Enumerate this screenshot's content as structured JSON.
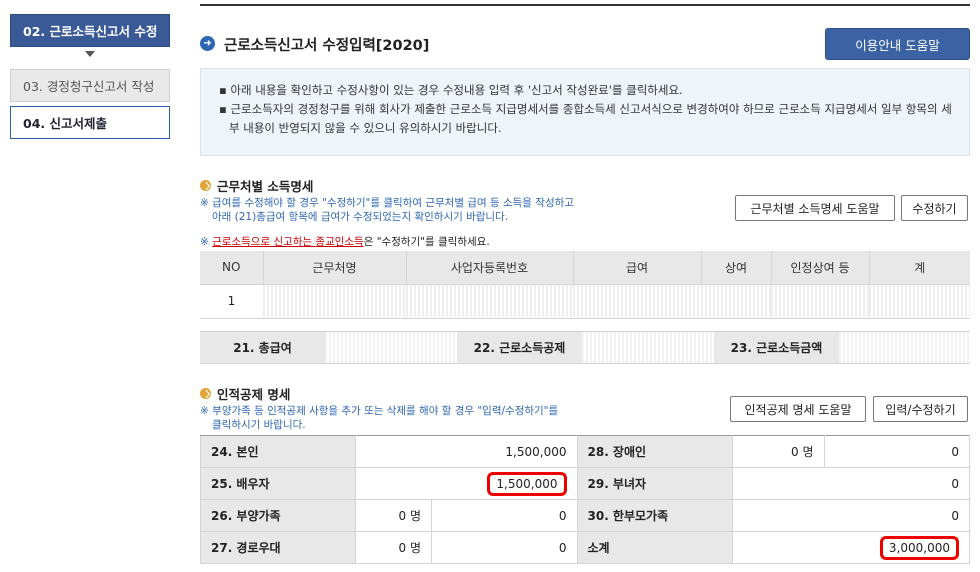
{
  "steps": {
    "s2": "02. 근로소득신고서 수정",
    "s3": "03. 경정청구신고서 작성",
    "s4": "04. 신고서제출"
  },
  "header": {
    "title": "근로소득신고서 수정입력[2020]",
    "help_button": "이용안내 도움말"
  },
  "notice": {
    "line1": "아래 내용을 확인하고 수정사항이 있는 경우 수정내용 입력 후 '신고서 작성완료'를 클릭하세요.",
    "line2": "근로소득자의 경정청구를 위해 회사가 제출한 근로소득 지급명세서를 종합소득세 신고서식으로 변경하여야 하므로 근로소득 지급명세서 일부 항목의 세부 내용이 반영되지 않을 수 있으니 유의하시기 바랍니다."
  },
  "section1": {
    "title": "근무처별 소득명세",
    "note1": "※ 급여를 수정해야 할 경우 \"수정하기\"를 클릭하여 근무처별 급여 등 소득을 작성하고",
    "note2": "아래 (21)총급여 항목에 급여가 수정되었는지 확인하시기 바랍니다.",
    "note3_prefix": "※ ",
    "note3_red": "근로소득으로 신고하는 종교인소득",
    "note3_suffix": "은 \"수정하기\"를 클릭하세요.",
    "help_button": "근무처별 소득명세 도움말",
    "edit_button": "수정하기",
    "columns": [
      "NO",
      "근무처명",
      "사업자등록번호",
      "급여",
      "상여",
      "인정상여 등",
      "계"
    ],
    "row_no": "1",
    "totals": {
      "l21": "21. 총급여",
      "l22": "22. 근로소득공제",
      "l23": "23. 근로소득금액"
    }
  },
  "section2": {
    "title": "인적공제 명세",
    "note1": "※ 부양가족 등 인적공제 사항을 추가 또는 삭제를 해야 할 경우 \"입력/수정하기\"를",
    "note2": "클릭하시기 바랍니다.",
    "help_button": "인적공제 명세 도움말",
    "edit_button": "입력/수정하기",
    "rows": {
      "l24": "24. 본인",
      "v24": "1,500,000",
      "l28": "28. 장애인",
      "c28": "0 명",
      "v28": "0",
      "l25": "25. 배우자",
      "v25": "1,500,000",
      "l29": "29. 부녀자",
      "v29": "0",
      "l26": "26. 부양가족",
      "c26": "0 명",
      "v26": "0",
      "l30": "30. 한부모가족",
      "v30": "0",
      "l27": "27. 경로우대",
      "c27": "0 명",
      "v27": "0",
      "lsum": "소계",
      "vsum": "3,000,000"
    }
  },
  "colors": {
    "accent": "#3b63a4",
    "highlight": "#ee0000"
  }
}
